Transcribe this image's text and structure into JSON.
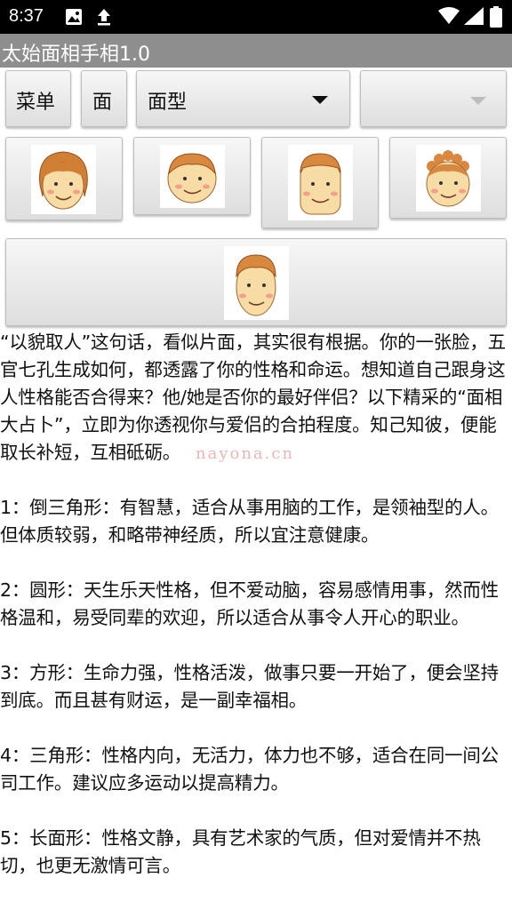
{
  "status_bar": {
    "time": "8:37",
    "icons": [
      "image-icon",
      "upload-icon",
      "wifi-icon",
      "signal-icon",
      "battery-icon"
    ]
  },
  "app": {
    "title": "太始面相手相1.0"
  },
  "toolbar": {
    "menu_label": "菜单",
    "face_label": "面",
    "shape_select_value": "面型",
    "second_select_value": ""
  },
  "face_buttons": [
    {
      "icon": "face-bob-hair-icon"
    },
    {
      "icon": "face-round-icon"
    },
    {
      "icon": "face-square-icon"
    },
    {
      "icon": "face-curly-hair-icon"
    },
    {
      "icon": "face-long-icon"
    }
  ],
  "article": {
    "paragraphs": [
      "“以貌取人”这句话，看似片面，其实很有根据。你的一张脸，五官七孔生成如何，都透露了你的性格和命运。想知道自己跟身这人性格能否合得来？他/她是否你的最好伴侣？以下精采的“面相大占卜”，立即为你透视你与爱侣的合拍程度。知己知彼，便能取长补短，互相砥砺。",
      "1：倒三角形：有智慧，适合从事用脑的工作，是领袖型的人。但体质较弱，和略带神经质，所以宜注意健康。",
      "2：圆形：天生乐天性格，但不爱动脑，容易感情用事，然而性格温和，易受同辈的欢迎，所以适合从事令人开心的职业。",
      "3：方形：生命力强，性格活泼，做事只要一开始了，便会坚持到底。而且甚有财运，是一副幸福相。",
      "4：三角形：性格内向，无活力，体力也不够，适合在同一间公司工作。建议应多运动以提高精力。",
      "5：长面形：性格文静，具有艺术家的气质，但对爱情并不热切，也更无激情可言。"
    ]
  },
  "watermark": "nayona.cn",
  "colors": {
    "status_bar": "#000000",
    "title_bar": "#8e8e8e",
    "button_face": "#e8e8e8",
    "skin": "#f7d9a0",
    "hair": "#c9742a"
  }
}
